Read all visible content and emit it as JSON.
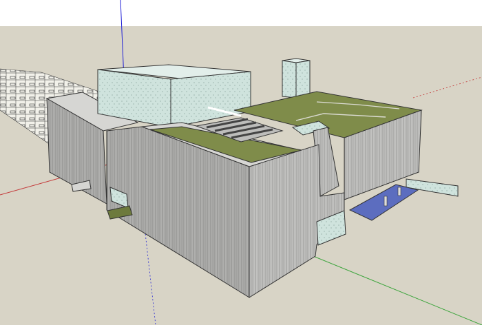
{
  "app": "SketchUp",
  "view": {
    "sky_color": "#ffffff",
    "ground_color": "#d8d4c6",
    "facade_color": "#bfbfbd",
    "glass_color": "#cfe3dd",
    "roof_green_color": "#7f8c4a",
    "axis_red": "#c43a3a",
    "axis_green": "#3aa43a",
    "axis_blue": "#1f1fd6",
    "glazing_blue": "#5c6dbf"
  },
  "model": {
    "parts": [
      "site-plan-underlay",
      "main-wall-block",
      "left-wing-block",
      "glass-tower",
      "stair-core-tower",
      "green-roof-left",
      "green-roof-main",
      "green-roof-right",
      "roof-skylight",
      "canopy-overhang",
      "underground-glazing",
      "entrance-recess"
    ]
  }
}
